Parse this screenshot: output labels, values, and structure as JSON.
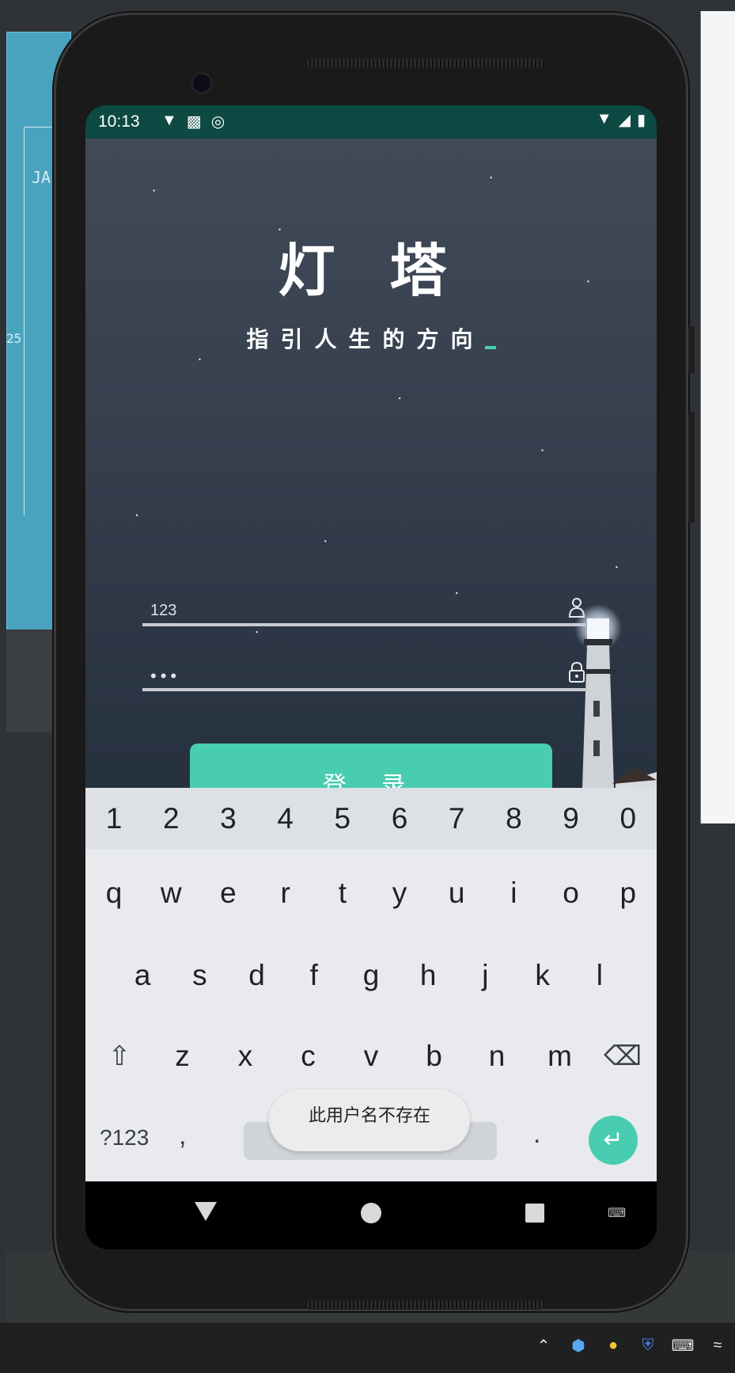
{
  "status_bar": {
    "time": "10:13"
  },
  "app": {
    "title": "灯 塔",
    "subtitle": "指引人生的方向"
  },
  "form": {
    "username_value": "123",
    "password_value": "•••",
    "login_label": "登 录"
  },
  "keyboard": {
    "numbers": [
      "1",
      "2",
      "3",
      "4",
      "5",
      "6",
      "7",
      "8",
      "9",
      "0"
    ],
    "row_q": [
      "q",
      "w",
      "e",
      "r",
      "t",
      "y",
      "u",
      "i",
      "o",
      "p"
    ],
    "row_a": [
      "a",
      "s",
      "d",
      "f",
      "g",
      "h",
      "j",
      "k",
      "l"
    ],
    "row_z": [
      "z",
      "x",
      "c",
      "v",
      "b",
      "n",
      "m"
    ],
    "symbols_label": "?123",
    "comma": ",",
    "period": "."
  },
  "toast": {
    "message": "此用户名不存在"
  },
  "desktop": {
    "left_label": "JA",
    "left_label2": "25"
  },
  "colors": {
    "accent": "#48cdb0",
    "status_bar": "#0d4a44",
    "keyboard_bg": "#e8eaed"
  },
  "icons": {
    "username_field": "person-icon",
    "password_field": "lock-icon",
    "enter_key": "enter-arrow-icon",
    "shift_key": "shift-arrow-icon",
    "backspace_key": "backspace-icon"
  }
}
